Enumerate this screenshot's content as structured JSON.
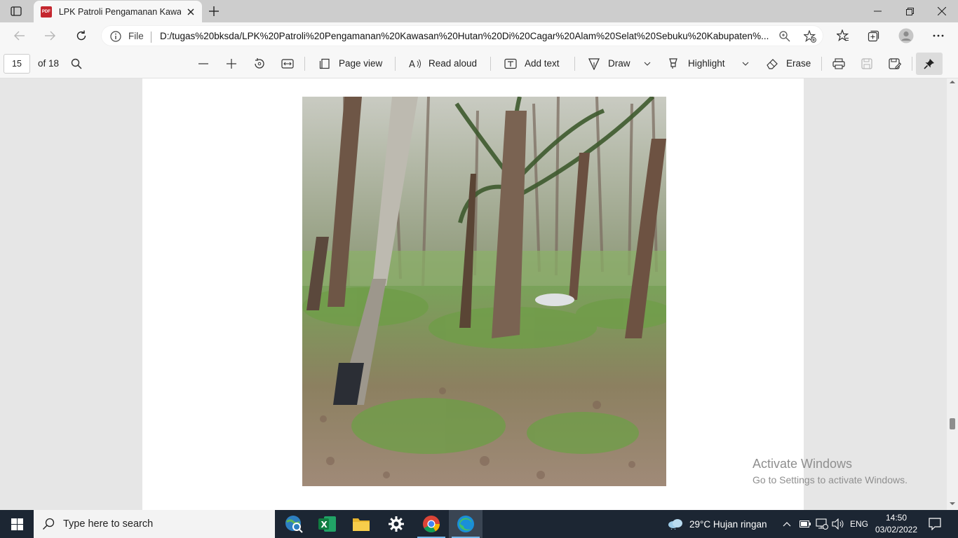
{
  "browser": {
    "tab_title": "LPK Patroli Pengamanan Kawasan",
    "file_label": "File",
    "url": "D:/tugas%20bksda/LPK%20Patroli%20Pengamanan%20Kawasan%20Hutan%20Di%20Cagar%20Alam%20Selat%20Sebuku%20Kabupaten%..."
  },
  "pdf_toolbar": {
    "page_number": "15",
    "page_total": "of 18",
    "page_view": "Page view",
    "read_aloud": "Read aloud",
    "add_text": "Add text",
    "draw": "Draw",
    "highlight": "Highlight",
    "erase": "Erase"
  },
  "watermark": {
    "line1": "Activate Windows",
    "line2": "Go to Settings to activate Windows."
  },
  "taskbar": {
    "search_placeholder": "Type here to search",
    "weather": "29°C  Hujan ringan",
    "language": "ENG",
    "time": "14:50",
    "date": "03/02/2022"
  },
  "colors": {
    "accent": "#0078d4",
    "pdf_icon": "#c4262e",
    "taskbar": "#1c2633"
  }
}
